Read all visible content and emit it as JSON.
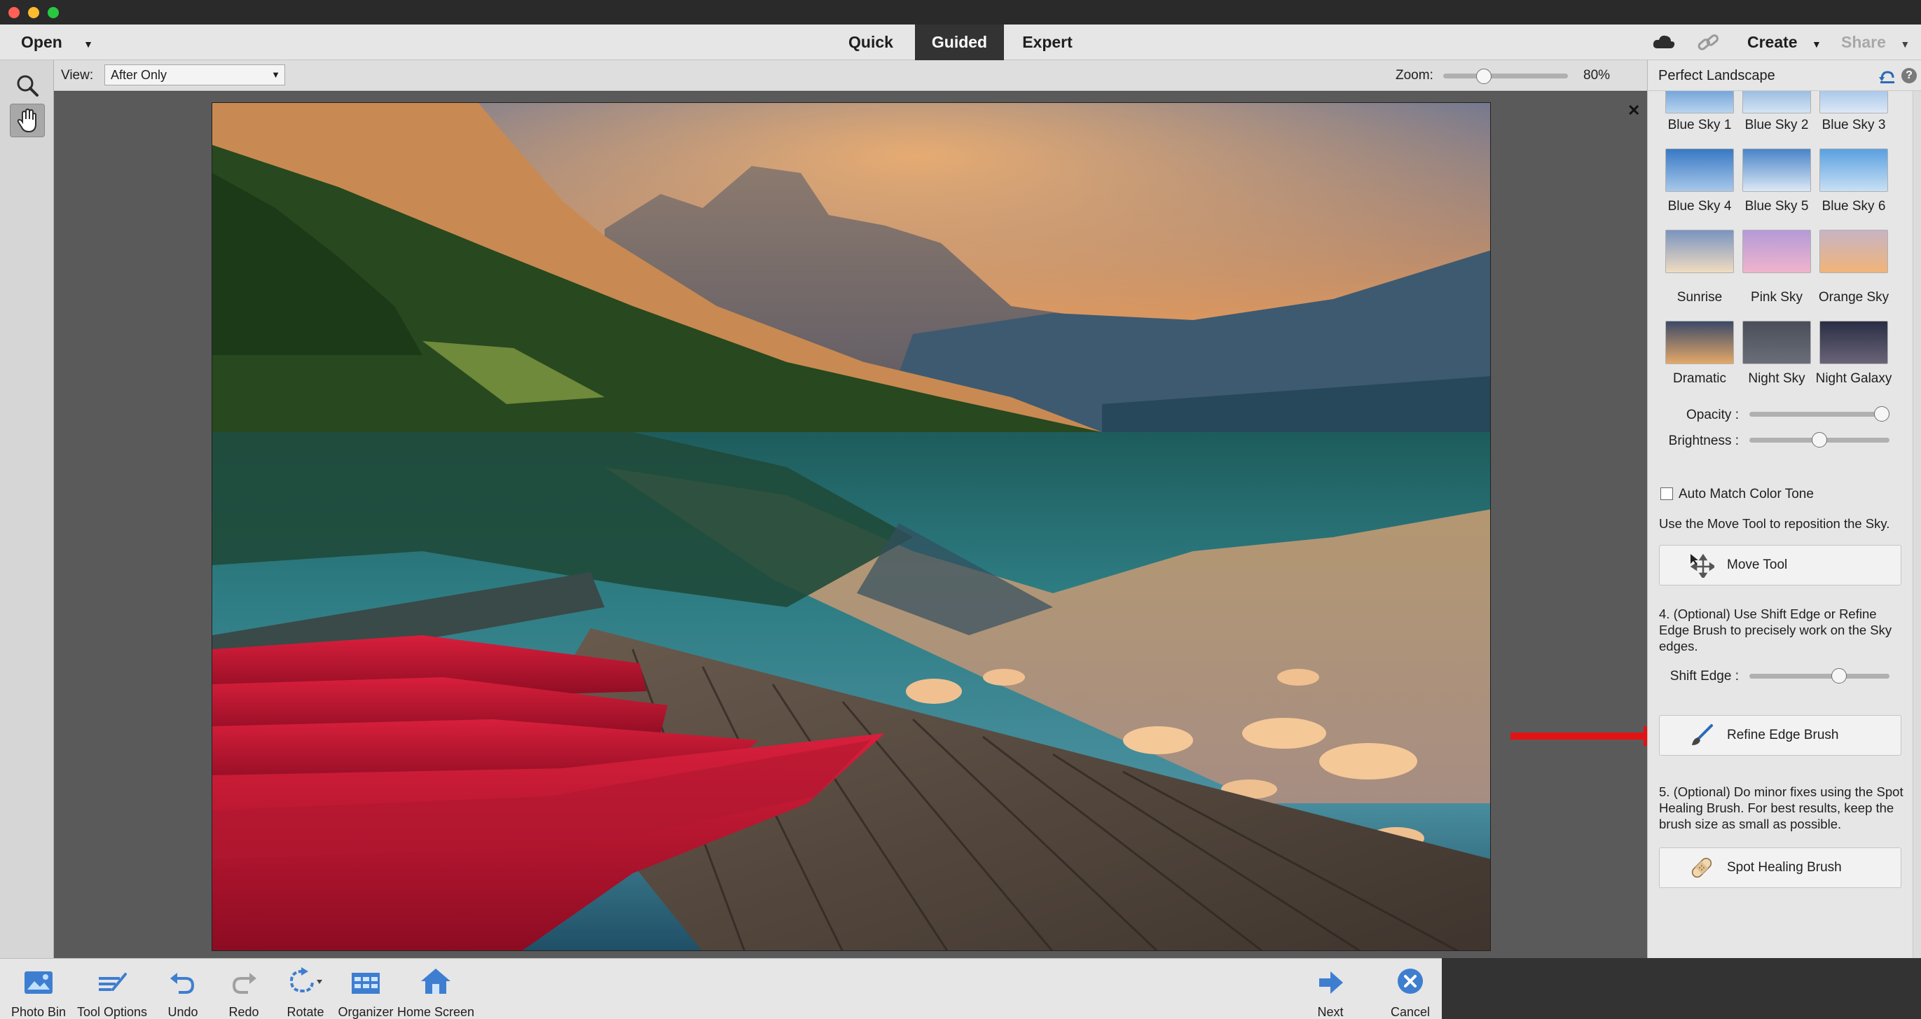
{
  "menubar": {
    "open_label": "Open",
    "modes": [
      "Quick",
      "Guided",
      "Expert"
    ],
    "active_mode": "Guided",
    "create_label": "Create",
    "share_label": "Share"
  },
  "options_bar": {
    "view_label": "View:",
    "view_value": "After Only",
    "zoom_label": "Zoom:",
    "zoom_value": "80%",
    "zoom_level": 0.3
  },
  "panel": {
    "title": "Perfect Landscape",
    "skies": [
      "Blue Sky 1",
      "Blue Sky 2",
      "Blue Sky 3",
      "Blue Sky 4",
      "Blue Sky 5",
      "Blue Sky 6",
      "Sunrise",
      "Pink Sky",
      "Orange Sky",
      "Dramatic",
      "Night Sky",
      "Night Galaxy"
    ],
    "opacity_label": "Opacity :",
    "opacity_level": 1.0,
    "brightness_label": "Brightness :",
    "brightness_level": 0.5,
    "auto_match_label": "Auto Match Color Tone",
    "auto_match_checked": false,
    "move_hint": "Use the Move Tool to reposition the Sky.",
    "move_tool_label": "Move Tool",
    "step4_text": "4. (Optional) Use Shift Edge or Refine Edge Brush to precisely work on the Sky edges.",
    "shift_edge_label": "Shift Edge :",
    "shift_edge_level": 0.66,
    "refine_brush_label": "Refine Edge Brush",
    "step5_text": "5. (Optional) Do minor fixes using the Spot Healing Brush. For best results, keep the brush size as small as possible.",
    "spot_healing_label": "Spot Healing Brush"
  },
  "bottombar": {
    "photo_bin": "Photo Bin",
    "tool_options": "Tool Options",
    "undo": "Undo",
    "redo": "Redo",
    "rotate": "Rotate",
    "organizer": "Organizer",
    "home_screen": "Home Screen",
    "next": "Next",
    "cancel": "Cancel"
  },
  "colors": {
    "accent_blue": "#2a6ab8",
    "annotation_red": "#e41212",
    "active_tab": "#333333"
  }
}
